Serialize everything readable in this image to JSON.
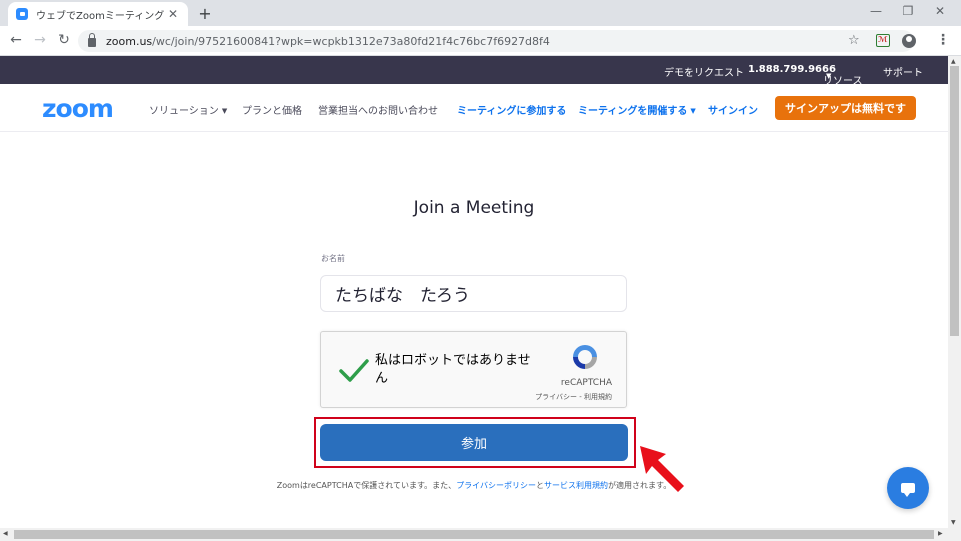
{
  "browser": {
    "tab_title": "ウェブでZoomミーティング - Zoom",
    "tab_close": "✕",
    "new_tab": "+",
    "url_host": "zoom.us",
    "url_rest": "/wc/join/97521600841?wpk=wcpkb1312e73a80fd21f4c76bc7f6927d8f4",
    "extension_badge": "ℳ"
  },
  "topbar": {
    "demo": "デモをリクエスト",
    "phone": "1.888.799.9666",
    "resources": "リソース",
    "support": "サポート"
  },
  "navbar": {
    "logo": "zoom",
    "solutions": "ソリューション",
    "pricing": "プランと価格",
    "contact_sales": "営業担当へのお問い合わせ",
    "join_meeting": "ミーティングに参加する",
    "host_meeting": "ミーティングを開催する",
    "sign_in": "サインイン",
    "sign_up": "サインアップは無料です"
  },
  "form": {
    "title": "Join a Meeting",
    "name_label": "お名前",
    "name_value": "たちばな　たろう",
    "join_button": "参加"
  },
  "recaptcha": {
    "checkbox_text": "私はロボットではありません",
    "brand": "reCAPTCHA",
    "links": "プライバシー - 利用規約"
  },
  "footer": {
    "prefix": "ZoomはreCAPTCHAで保護されています。また、",
    "privacy_link": "プライバシーポリシー",
    "and": "と",
    "terms_link": "サービス利用規約",
    "suffix": "が適用されます。"
  },
  "colors": {
    "brand_blue": "#2d8cff",
    "nav_blue": "#0e72ed",
    "signup_orange": "#e8720c",
    "join_button": "#2a6fbd",
    "topbar": "#38364c",
    "highlight_red": "#d0021b"
  },
  "icons": {
    "back": "back-arrow-icon",
    "forward": "forward-arrow-icon",
    "reload": "reload-icon",
    "lock": "lock-icon",
    "star": "star-icon",
    "profile": "profile-icon",
    "menu": "kebab-menu-icon",
    "check": "checkmark-icon",
    "recaptcha": "recaptcha-logo-icon",
    "chat": "chat-icon",
    "annotation_arrow": "red-arrow-icon"
  }
}
